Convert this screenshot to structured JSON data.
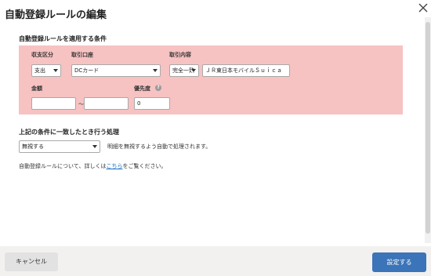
{
  "dialog": {
    "title": "自動登録ルールの編集"
  },
  "conditions": {
    "section_title": "自動登録ルールを適用する条件",
    "type_label": "収支区分",
    "type_value": "支出",
    "account_label": "取引口座",
    "account_value": "DCカード",
    "content_label": "取引内容",
    "match_value": "完全一致",
    "content_value": "ＪＲ東日本モバイルＳｕｉｃａ",
    "amount_label": "金額",
    "amount_min": "",
    "amount_max": "",
    "range_separator": "～",
    "priority_label": "優先度",
    "priority_value": "0",
    "help_glyph": "?"
  },
  "action": {
    "section_title": "上記の条件に一致したとき行う処理",
    "action_value": "無視する",
    "action_description": "明細を無視するよう自動で処理されます。"
  },
  "note": {
    "prefix": "自動登録ルールについて、詳しくは",
    "link_text": "こちら",
    "suffix": "をご覧ください。"
  },
  "footer": {
    "cancel_label": "キャンセル",
    "submit_label": "設定する"
  },
  "colors": {
    "condition_background": "#f7c2c2",
    "primary_button": "#3b74b8",
    "link": "#1a6fc4"
  },
  "icons": {
    "close": "close-icon",
    "help": "help-icon",
    "dropdown": "chevron-down-icon"
  }
}
